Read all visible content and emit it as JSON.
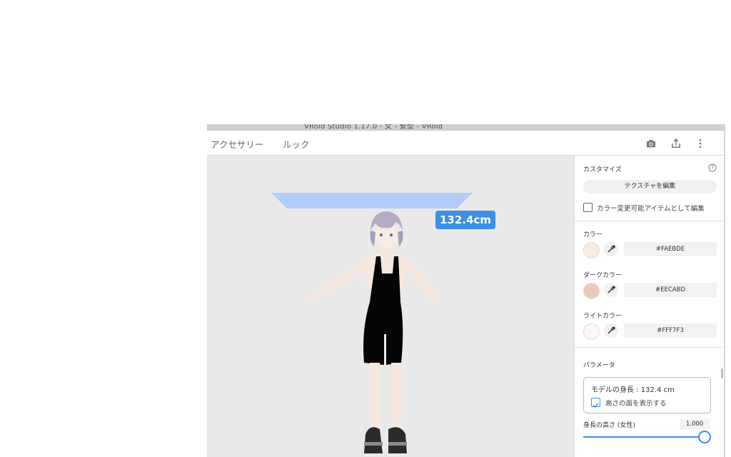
{
  "window": {
    "title": "VRoid Studio 1.17.0 - 女 - 髪型 - VRoid"
  },
  "tabs": [
    {
      "label": "アクセサリー"
    },
    {
      "label": "ルック"
    }
  ],
  "toolbar_icons": [
    "camera-icon",
    "share-icon",
    "more-vert-icon"
  ],
  "viewport": {
    "height_label": "132.4cm"
  },
  "panel": {
    "customize": {
      "title": "カスタマイズ",
      "help_icon": "help-icon",
      "edit_texture_button": "テクスチャを編集",
      "color_changeable_label": "カラー変更可能アイテムとして編集",
      "color_changeable_checked": false
    },
    "colors": [
      {
        "label": "カラー",
        "hex": "#FAEBDE",
        "swatch": "#FAEBDE"
      },
      {
        "label": "ダークカラー",
        "hex": "#EECABD",
        "swatch": "#EECABD"
      },
      {
        "label": "ライトカラー",
        "hex": "#FFF7F3",
        "swatch": "#FFF7F3"
      }
    ],
    "parameters": {
      "title": "パラメータ",
      "model_height_text": "モデルの身長 : 132.4 cm",
      "show_height_plane_label": "高さの面を表示する",
      "show_height_plane_checked": true,
      "slider_label": "身長の高さ (女性)",
      "slider_value": "1.000",
      "slider_fraction": 1.0
    }
  },
  "accent_color": "#3D8FE7"
}
